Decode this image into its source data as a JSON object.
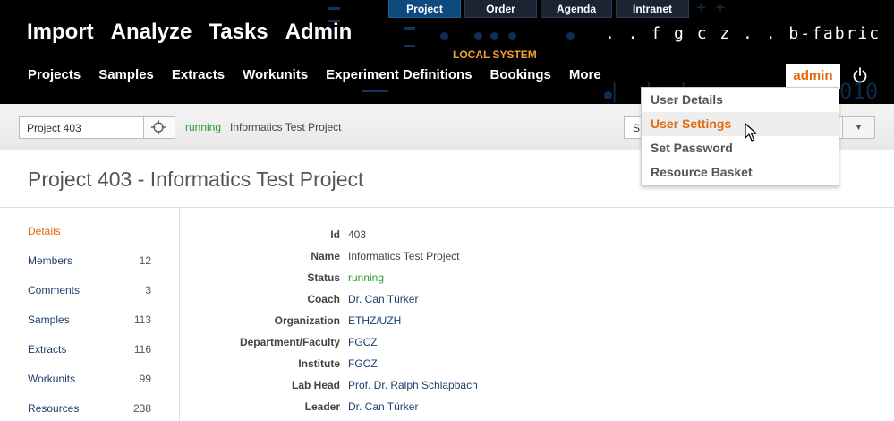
{
  "top_tabs": [
    {
      "label": "Project",
      "active": true
    },
    {
      "label": "Order",
      "active": false
    },
    {
      "label": "Agenda",
      "active": false
    },
    {
      "label": "Intranet",
      "active": false
    }
  ],
  "main_nav": [
    "Import",
    "Analyze",
    "Tasks",
    "Admin"
  ],
  "brand": ". . f g c z . . b-fabric",
  "environment_label": "LOCAL SYSTEM",
  "decoration_digits": "010",
  "sub_nav": [
    "Projects",
    "Samples",
    "Extracts",
    "Workunits",
    "Experiment Definitions",
    "Bookings",
    "More"
  ],
  "user": {
    "name": "admin"
  },
  "user_menu": [
    {
      "label": "User Details",
      "hover": false
    },
    {
      "label": "User Settings",
      "hover": true
    },
    {
      "label": "Set Password",
      "hover": false
    },
    {
      "label": "Resource Basket",
      "hover": false
    }
  ],
  "toolbar": {
    "project_value": "Project 403",
    "status": "running",
    "project_name": "Informatics Test Project",
    "select_value": "S"
  },
  "page_title": "Project 403 - Informatics Test Project",
  "sidebar": [
    {
      "label": "Details",
      "count": "",
      "active": true
    },
    {
      "label": "Members",
      "count": "12",
      "active": false
    },
    {
      "label": "Comments",
      "count": "3",
      "active": false
    },
    {
      "label": "Samples",
      "count": "113",
      "active": false
    },
    {
      "label": "Extracts",
      "count": "116",
      "active": false
    },
    {
      "label": "Workunits",
      "count": "99",
      "active": false
    },
    {
      "label": "Resources",
      "count": "238",
      "active": false
    }
  ],
  "details": [
    {
      "label": "Id",
      "value": "403",
      "style": "plain"
    },
    {
      "label": "Name",
      "value": "Informatics Test Project",
      "style": "plain"
    },
    {
      "label": "Status",
      "value": "running",
      "style": "green"
    },
    {
      "label": "Coach",
      "value": "Dr. Can Türker",
      "style": "link"
    },
    {
      "label": "Organization",
      "value": "ETHZ/UZH",
      "style": "link"
    },
    {
      "label": "Department/Faculty",
      "value": "FGCZ",
      "style": "link"
    },
    {
      "label": "Institute",
      "value": "FGCZ",
      "style": "link"
    },
    {
      "label": "Lab Head",
      "value": "Prof. Dr. Ralph Schlapbach",
      "style": "link"
    },
    {
      "label": "Leader",
      "value": "Dr. Can Türker",
      "style": "link"
    }
  ],
  "colors": {
    "accent": "#e06a10",
    "link": "#1d3f6e",
    "status_green": "#2a9a2a",
    "header_bg": "#000000"
  },
  "icons": {
    "power": "power-icon",
    "target": "crosshair-icon",
    "dropdown": "caret-down-icon",
    "cursor": "mouse-pointer-icon"
  }
}
